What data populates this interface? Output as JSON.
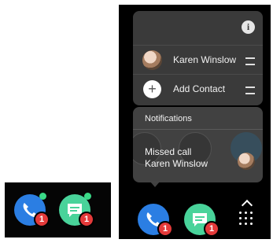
{
  "left_dock": {
    "apps": [
      {
        "name": "phone",
        "badge": "1"
      },
      {
        "name": "messages",
        "badge": "1"
      }
    ]
  },
  "popup": {
    "info_icon": "i",
    "contacts": [
      {
        "label": "Karen Winslow",
        "icon": "avatar"
      },
      {
        "label": "Add Contact",
        "icon": "plus-icon"
      }
    ],
    "plus_glyph": "+"
  },
  "notifications": {
    "title": "Notifications",
    "message_line1": "Missed call",
    "message_line2": "Karen Winslow"
  },
  "dock": {
    "apps": [
      {
        "name": "phone",
        "badge": "1"
      },
      {
        "name": "messages",
        "badge": "1"
      }
    ]
  },
  "colors": {
    "phone": "#2b7ee3",
    "messages": "#49d39a",
    "badge": "#e43a3a",
    "indicator": "#3ad987"
  }
}
